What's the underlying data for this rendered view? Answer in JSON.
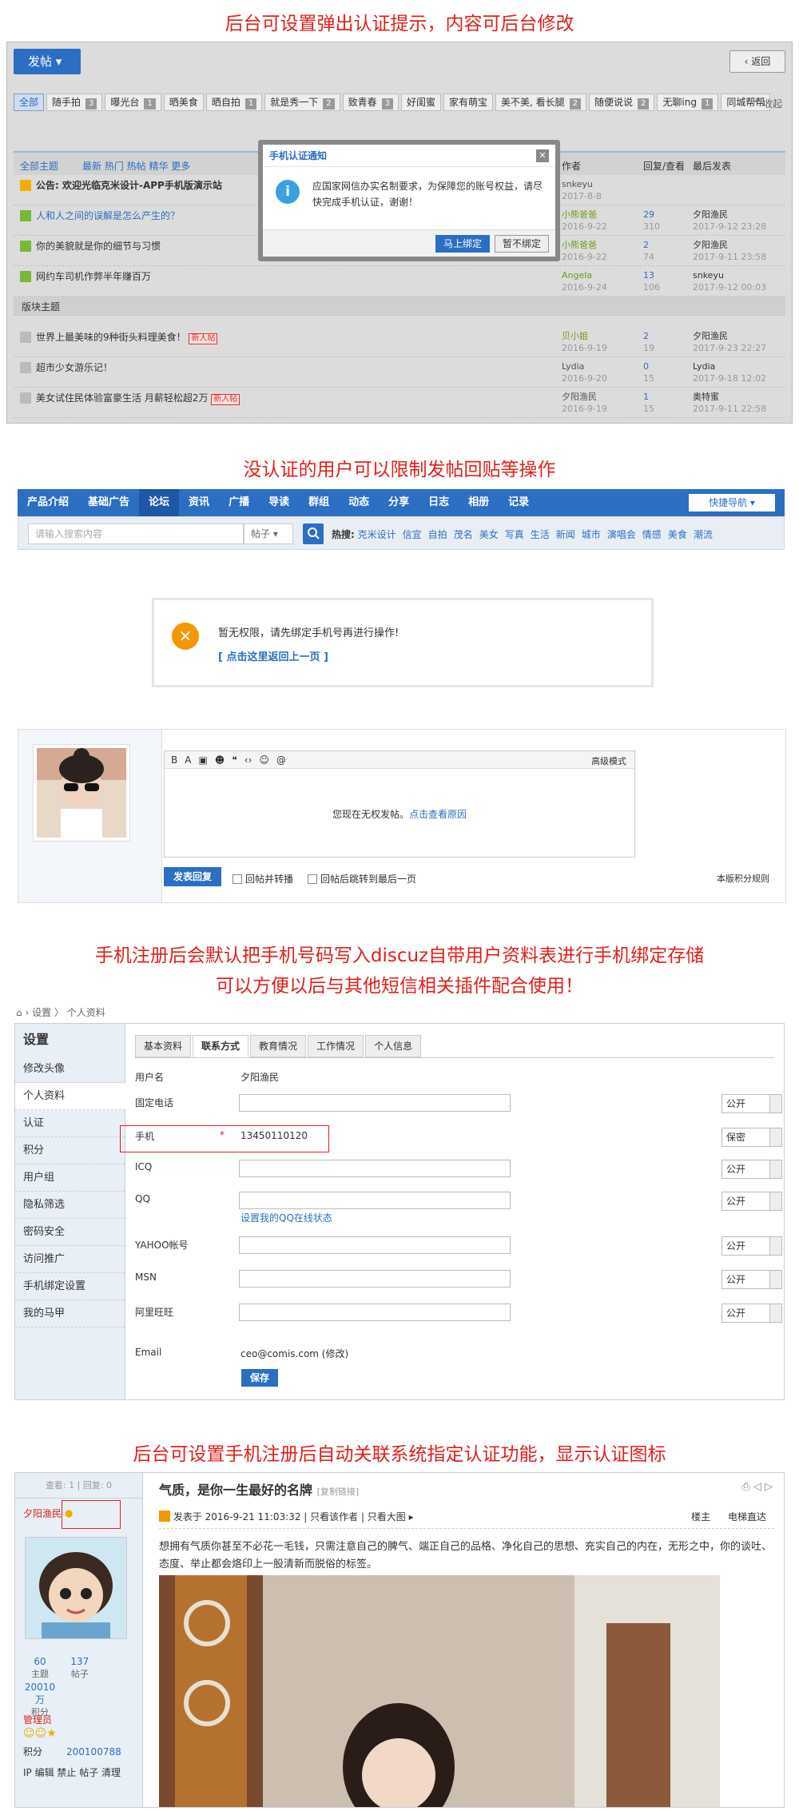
{
  "banners": {
    "b1": "后台可设置弹出认证提示，内容可后台修改",
    "b2": "没认证的用户可以限制发帖回贴等操作",
    "b3a": "手机注册后会默认把手机号码写入discuz自带用户资料表进行手机绑定存储",
    "b3b": "可以方便以后与其他短信相关插件配合使用！",
    "b4": "后台可设置手机注册后自动关联系统指定认证功能，显示认证图标"
  },
  "forum": {
    "post_button": "发帖",
    "back_button": "返回",
    "collapse": "收起",
    "tags": [
      {
        "label": "全部",
        "n": ""
      },
      {
        "label": "随手拍",
        "n": "3"
      },
      {
        "label": "曝光台",
        "n": "1"
      },
      {
        "label": "晒美食",
        "n": ""
      },
      {
        "label": "晒自拍",
        "n": "1"
      },
      {
        "label": "就是秀一下",
        "n": "2"
      },
      {
        "label": "致青春",
        "n": "3"
      },
      {
        "label": "好闺蜜",
        "n": ""
      },
      {
        "label": "家有萌宝",
        "n": ""
      },
      {
        "label": "美不美, 看长腿",
        "n": "2"
      },
      {
        "label": "随便说说",
        "n": "2"
      },
      {
        "label": "无聊ing",
        "n": "1"
      },
      {
        "label": "同城帮帮",
        "n": ""
      }
    ],
    "header": {
      "all": "全部主题",
      "filters": "最新  热门  热帖  精华  更多",
      "author": "作者",
      "replies": "回复/查看",
      "last": "最后发表"
    },
    "rows": [
      {
        "title": "公告: 欢迎光临克米设计-APP手机版演示站",
        "author": "snkeyu",
        "adate": "2017-8-8",
        "r": "",
        "v": "",
        "last": "",
        "ldate": ""
      },
      {
        "title": "人和人之间的误解是怎么产生的？",
        "author": "小熊爸爸",
        "adate": "2016-9-22",
        "r": "29",
        "v": "310",
        "last": "夕阳渔民",
        "ldate": "2017-9-12 23:28"
      },
      {
        "title": "你的美貌就是你的细节与习惯",
        "author": "小熊爸爸",
        "adate": "2016-9-22",
        "r": "2",
        "v": "74",
        "last": "夕阳渔民",
        "ldate": "2017-9-11 23:58"
      },
      {
        "title": "网约车司机作弊半年赚百万",
        "author": "Angela",
        "adate": "2016-9-24",
        "r": "13",
        "v": "106",
        "last": "snkeyu",
        "ldate": "2017-9-12 00:03"
      },
      {
        "title": "版块主题",
        "author": "",
        "adate": "",
        "r": "",
        "v": "",
        "last": "",
        "ldate": ""
      },
      {
        "title": "世界上最美味的9种街头料理美食！",
        "author": "贝小姐",
        "adate": "2016-9-19",
        "r": "2",
        "v": "19",
        "last": "夕阳渔民",
        "ldate": "2017-9-23 22:27"
      },
      {
        "title": "超市少女游乐记！",
        "author": "Lydia",
        "adate": "2016-9-20",
        "r": "0",
        "v": "15",
        "last": "Lydia",
        "ldate": "2017-9-18 12:02"
      },
      {
        "title": "美女试住民体验富豪生活 月薪轻松超2万",
        "author": "夕阳渔民",
        "adate": "2016-9-19",
        "r": "1",
        "v": "15",
        "last": "奥特蜜",
        "ldate": "2017-9-11 22:58"
      }
    ],
    "new_badge": "新人帖",
    "dialog": {
      "title": "手机认证通知",
      "message": "应国家网信办实名制要求，为保障您的账号权益，请尽快完成手机认证，谢谢！",
      "ok": "马上绑定",
      "cancel": "暂不绑定"
    }
  },
  "nav": {
    "items": [
      "产品介绍",
      "基础广告",
      "论坛",
      "资讯",
      "广播",
      "导读",
      "群组",
      "动态",
      "分享",
      "日志",
      "相册",
      "记录"
    ],
    "quick": "快捷导航",
    "search_placeholder": "请输入搜索内容",
    "search_type": "帖子",
    "hot_label": "热搜:",
    "hot": [
      "克米设计",
      "信宜",
      "自拍",
      "茂名",
      "美女",
      "写真",
      "生活",
      "新闻",
      "城市",
      "演唱会",
      "情感",
      "美食",
      "潮流"
    ]
  },
  "perm": {
    "line1": "暂无权限，请先绑定手机号再进行操作!",
    "line2": "[ 点击这里返回上一页 ]"
  },
  "reply": {
    "toolbar": [
      "B",
      "A",
      "▣",
      "☻",
      "❝",
      "‹›",
      "☺",
      "@"
    ],
    "mode": "高级模式",
    "nopost": "您现在无权发帖。",
    "reason": "点击查看原因",
    "send": "发表回复",
    "c1": "回帖并转播",
    "c2": "回帖后跳转到最后一页",
    "rules": "本版积分规则"
  },
  "settings": {
    "crumb": "设置  〉 个人资料",
    "side_title": "设置",
    "side": [
      "修改头像",
      "个人资料",
      "认证",
      "积分",
      "用户组",
      "隐私筛选",
      "密码安全",
      "访问推广",
      "手机绑定设置",
      "我的马甲"
    ],
    "tabs": [
      "基本资料",
      "联系方式",
      "教育情况",
      "工作情况",
      "个人信息"
    ],
    "username_label": "用户名",
    "username": "夕阳渔民",
    "fields": [
      {
        "label": "固定电话",
        "value": "",
        "privacy": "公开"
      },
      {
        "label": "手机",
        "value": "13450110120",
        "privacy": "保密"
      },
      {
        "label": "ICQ",
        "value": "",
        "privacy": "公开"
      },
      {
        "label": "QQ",
        "value": "",
        "privacy": "公开",
        "sub": "设置我的QQ在线状态"
      },
      {
        "label": "YAHOO帐号",
        "value": "",
        "privacy": "公开"
      },
      {
        "label": "MSN",
        "value": "",
        "privacy": "公开"
      },
      {
        "label": "阿里旺旺",
        "value": "",
        "privacy": "公开"
      }
    ],
    "email_label": "Email",
    "email": "ceo@comis.com (修改)",
    "save": "保存"
  },
  "post": {
    "stats": "查看: 1  |  回复: 0",
    "author": "夕阳渔民",
    "topics": "60",
    "topics_l": "主题",
    "posts": "137",
    "posts_l": "帖子",
    "credits": "20010\n万",
    "credits_l": "积分",
    "group": "管理员",
    "credit_label": "积分",
    "credit_value": "200100788",
    "actions": "IP  编辑  禁止  帖子  清理",
    "title": "气质，是你一生最好的名牌",
    "copy": "[复制链接]",
    "meta": "发表于 2016-9-21 11:03:32  |  只看该作者  |  只看大图 ▸",
    "floor": "楼主",
    "jump": "电梯直达",
    "body": "想拥有气质你甚至不必花一毛钱，只需注意自己的脾气、端正自己的品格、净化自己的思想、充实自己的内在，无形之中，你的谈吐、态度、举止都会烙印上一股清新而脱俗的标签。"
  }
}
